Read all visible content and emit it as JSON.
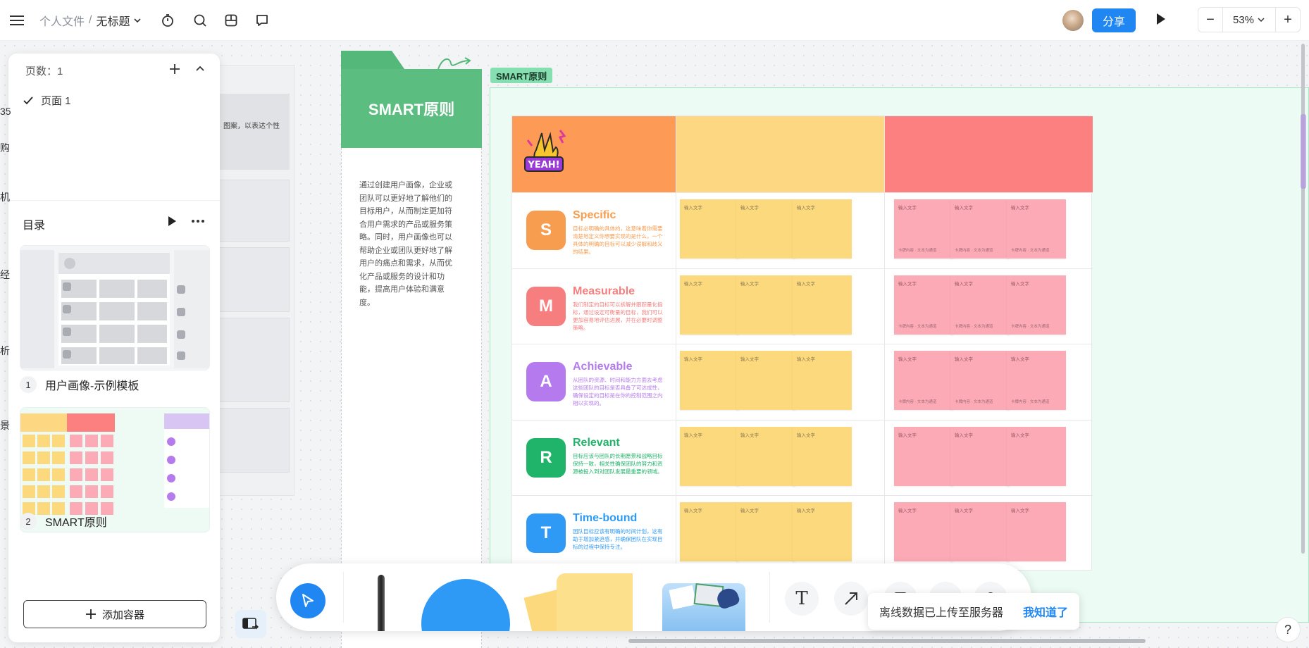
{
  "topbar": {
    "breadcrumb_root": "个人文件",
    "breadcrumb_sep": "/",
    "breadcrumb_current": "无标题",
    "share_label": "分享",
    "zoom_value": "53%",
    "zoom_minus": "−",
    "zoom_plus": "+"
  },
  "left_panel": {
    "pages_count_label": "页数：1",
    "pages": [
      {
        "label": "页面 1",
        "selected": true
      }
    ],
    "toc_title": "目录",
    "toc_items": [
      {
        "num": "1",
        "label": "用户画像-示例模板"
      },
      {
        "num": "2",
        "label": "SMART原则"
      }
    ],
    "add_container_label": "添加容器"
  },
  "canvas": {
    "behind_panel_header_text": "图案，以表达个性",
    "left_edge_fragments": [
      "35",
      "购",
      "机",
      "经",
      "析",
      "景"
    ],
    "folder_title": "SMART原则",
    "folder_description": "通过创建用户画像，企业或团队可以更好地了解他们的目标用户，从而制定更加符合用户需求的产品或服务策略。同时，用户画像也可以帮助企业或团队更好地了解用户的痛点和需求，从而优化产品或服务的设计和功能，提高用户体验和满意度。",
    "frame_label": "SMART原则",
    "sticker_text": "YEAH!",
    "criteria": [
      {
        "letter": "S",
        "title": "Specific",
        "color": "#f79d4f",
        "desc": "目标必明确的具体的，这意味着你需要清楚地定义你想要实现的是什么，一个具体的明确的目标可以减少误解和歧义的结果。"
      },
      {
        "letter": "M",
        "title": "Measurable",
        "color": "#f67e7e",
        "desc": "我们制定的目标可以拆解并跟踪量化指标，通过设定可衡量的目标，我们可以更加容易地评估进展，并在必要时调整策略。"
      },
      {
        "letter": "A",
        "title": "Achievable",
        "color": "#b57bee",
        "desc": "从团队的资源、时间和能力方面去考虑这些团队的目标是否具备了可达成性，确保设定的目标是在你的控制范围之内相以实现的。"
      },
      {
        "letter": "R",
        "title": "Relevant",
        "color": "#1fb46a",
        "desc": "目标应该与团队的长期愿景和战略目标保持一致，相关性确保团队的努力和资源被投入到对团队发展最重要的领域。"
      },
      {
        "letter": "T",
        "title": "Time-bound",
        "color": "#2f9af5",
        "desc": "团队目标应该有明确的时间计划，这有助于增加紧迫感，并确保团队在实现目标的过程中保持专注。"
      }
    ],
    "note_placeholder": "输入文字",
    "note_footer": "卡牌内容 · 文本为通道",
    "header_colors": {
      "c1": "#fd9b56",
      "c2": "#fdd781",
      "c3": "#fc8080"
    }
  },
  "toolbar": {
    "text_tool_glyph": "T"
  },
  "toast": {
    "message": "离线数据已上传至服务器",
    "ack_label": "我知道了"
  },
  "help_label": "?"
}
